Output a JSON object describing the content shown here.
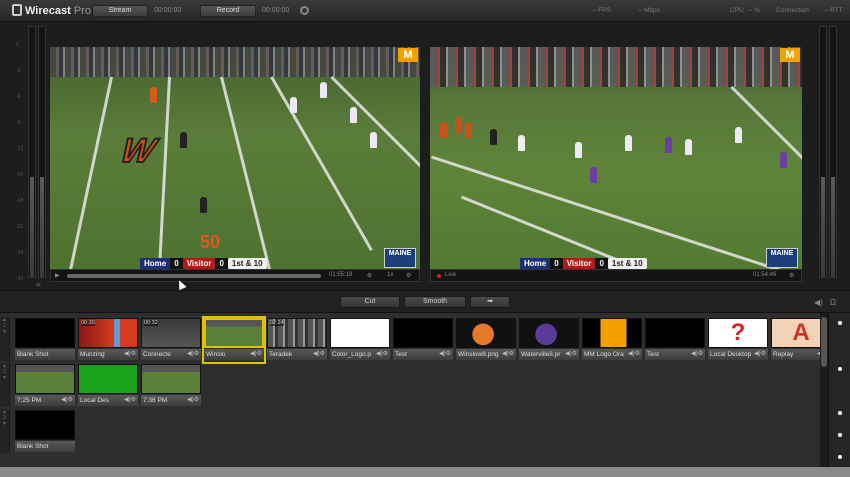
{
  "app": {
    "name_bold": "Wirecast",
    "name_light": " Pro"
  },
  "toolbar": {
    "stream_label": "Stream",
    "stream_time": "00:00:00",
    "record_label": "Record",
    "record_time": "00:00:00",
    "fps_label": "-- FPS",
    "mbps_label": "-- Mbps",
    "cpu_label": "CPU",
    "cpu_value": "-- %",
    "connection_label": "Connection",
    "conn_value": "-- RTT"
  },
  "preview": {
    "score": {
      "home": "Home",
      "home_score": "0",
      "visitor": "Visitor",
      "visitor_score": "0",
      "down": "1st & 10"
    },
    "maine_label": "MAINE",
    "brand_letter": "M",
    "yard_number": "50",
    "left_time": "01:55:18",
    "left_speed": "1x",
    "right_live": "Live",
    "right_time": "01:54:46"
  },
  "meter_scale": [
    "0",
    "-3",
    "-6",
    "-9",
    "-12",
    "-15",
    "-18",
    "-21",
    "-24",
    "-30"
  ],
  "transition": {
    "cut_label": "Cut",
    "smooth_label": "Smooth",
    "go_arrow": "➡"
  },
  "layers": [
    {
      "shots": [
        {
          "label": "Blank Shot",
          "thumb": "black",
          "tc": ""
        },
        {
          "label": "Munzing",
          "thumb": "red",
          "tc": "00:30"
        },
        {
          "label": "Connecte",
          "thumb": "gray",
          "tc": "00:32"
        },
        {
          "label": "Winslo",
          "thumb": "field",
          "tc": "",
          "selected": true
        },
        {
          "label": "Teradek",
          "thumb": "crowd",
          "tc": "02:24"
        },
        {
          "label": "Color_Logo.p",
          "thumb": "moose",
          "tc": ""
        },
        {
          "label": "Test",
          "thumb": "black",
          "tc": ""
        },
        {
          "label": "Winslow8.png",
          "thumb": "helmet-orange",
          "tc": ""
        },
        {
          "label": "Waterville8.pr",
          "thumb": "helmet-purple",
          "tc": ""
        },
        {
          "label": "MM Logo Ora",
          "thumb": "mlogo",
          "tc": ""
        },
        {
          "label": "Test",
          "thumb": "black",
          "tc": ""
        },
        {
          "label": "Local Desktop",
          "thumb": "question",
          "tc": ""
        },
        {
          "label": "Replay",
          "thumb": "replay",
          "tc": ""
        }
      ]
    },
    {
      "shots": [
        {
          "label": "7:25 PM",
          "thumb": "field",
          "tc": ""
        },
        {
          "label": "Local Des",
          "thumb": "green",
          "tc": ""
        },
        {
          "label": "7:36 PM",
          "thumb": "field",
          "tc": ""
        }
      ]
    },
    {
      "shots": [
        {
          "label": "Blank Shot",
          "thumb": "black",
          "tc": ""
        }
      ]
    }
  ],
  "colors": {
    "selected": "#e0c200",
    "accent": "#f2a100",
    "home": "#1e2f7a",
    "visitor": "#b01a1a"
  }
}
